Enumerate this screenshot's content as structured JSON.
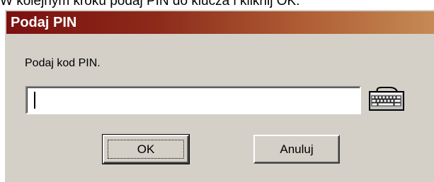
{
  "page": {
    "instruction_text": "W kolejnym kroku podaj PIN do klucza i kliknij OK."
  },
  "dialog": {
    "title": "Podaj PIN",
    "prompt_label": "Podaj kod PIN.",
    "pin_value": "",
    "keyboard_icon": "keyboard-icon",
    "buttons": {
      "ok_label": "OK",
      "cancel_label": "Anuluj"
    },
    "colors": {
      "title_gradient_start": "#7b1010",
      "title_gradient_end": "#c58a55",
      "dialog_face": "#d4d0c8"
    }
  }
}
